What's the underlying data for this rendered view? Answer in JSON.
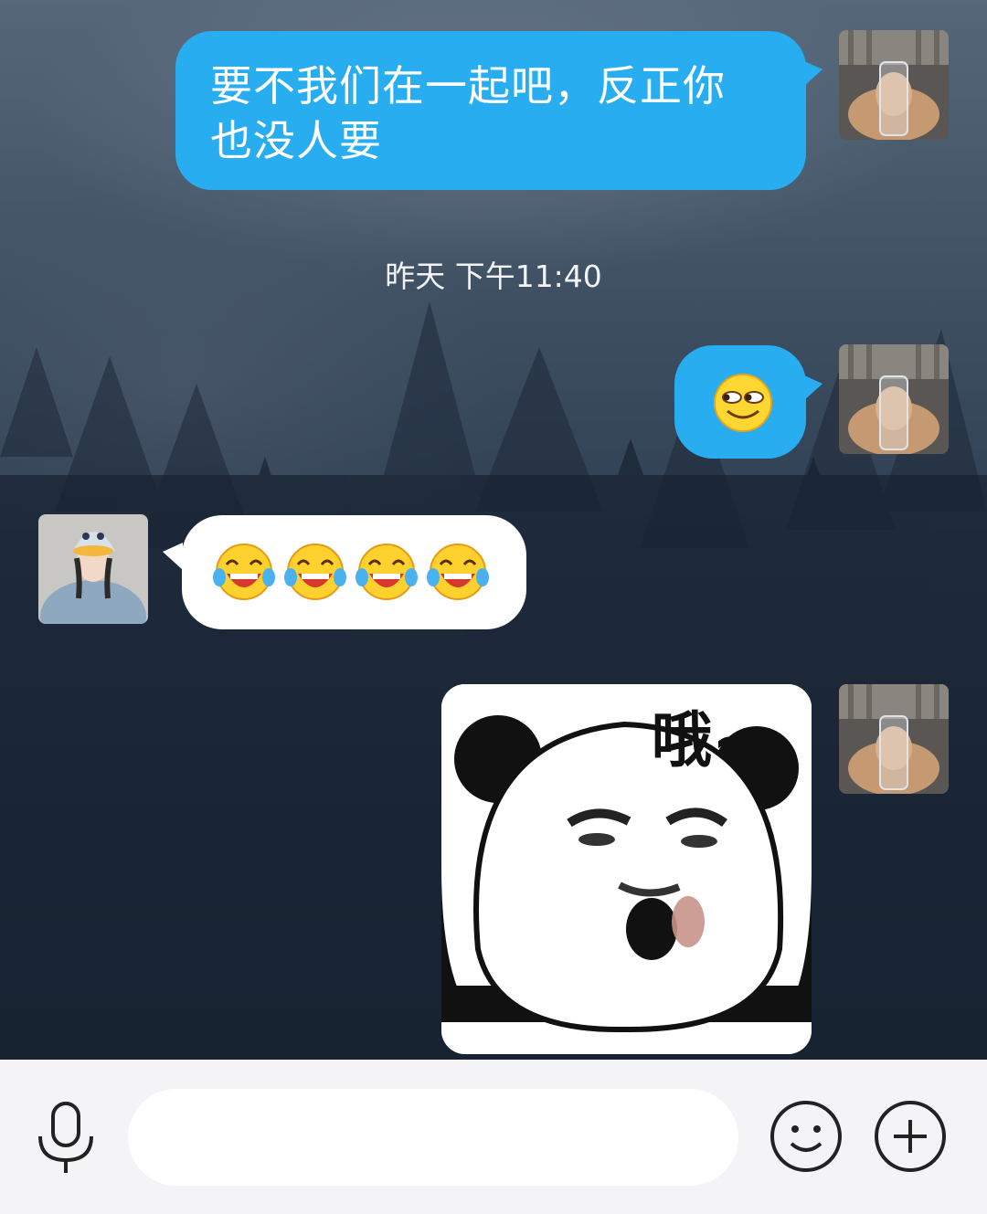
{
  "messages": [
    {
      "side": "right",
      "type": "text",
      "text_line1": "要不我们在一起吧，反正你",
      "text_line2": "也没人要"
    },
    {
      "type": "timestamp",
      "text": "昨天 下午11:40"
    },
    {
      "side": "right",
      "type": "emoji",
      "emoji": "smirk-emoji"
    },
    {
      "side": "left",
      "type": "emoji",
      "emoji": "tears-of-joy-emoji",
      "count": 4
    },
    {
      "side": "right",
      "type": "sticker",
      "caption": "哦~",
      "sticker": "panda-meme"
    }
  ],
  "input_bar": {
    "voice_icon": "microphone-icon",
    "text_value": "",
    "emoji_icon": "smiley-icon",
    "plus_icon": "plus-icon"
  },
  "colors": {
    "sent_bubble": "#27adf0",
    "received_bubble": "#ffffff",
    "input_bar_bg": "#f4f4f6"
  }
}
